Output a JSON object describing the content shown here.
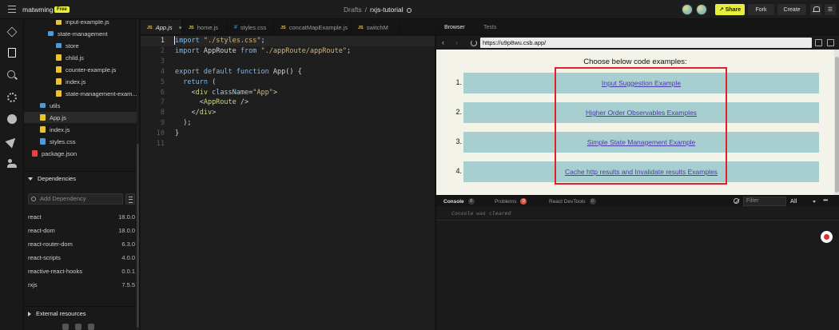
{
  "header": {
    "username": "matwming",
    "plan_badge": "Free",
    "breadcrumb_folder": "Drafts",
    "breadcrumb_separator": "/",
    "project_name": "rxjs-tutorial",
    "share_label": "Share",
    "fork_label": "Fork",
    "create_label": "Create"
  },
  "file_tree": {
    "items": [
      {
        "name": "input-example.js",
        "type": "js",
        "indent": 3
      },
      {
        "name": "state-management",
        "type": "folder",
        "indent": 2
      },
      {
        "name": "store",
        "type": "folder",
        "indent": 3
      },
      {
        "name": "child.js",
        "type": "js",
        "indent": 3
      },
      {
        "name": "counter-example.js",
        "type": "js",
        "indent": 3
      },
      {
        "name": "index.js",
        "type": "js",
        "indent": 3
      },
      {
        "name": "state-management-exam...",
        "type": "js",
        "indent": 3
      },
      {
        "name": "utils",
        "type": "folder",
        "indent": 1
      },
      {
        "name": "App.js",
        "type": "js",
        "indent": 1,
        "active": true
      },
      {
        "name": "index.js",
        "type": "js",
        "indent": 1
      },
      {
        "name": "styles.css",
        "type": "css",
        "indent": 1
      },
      {
        "name": "package.json",
        "type": "json",
        "indent": 0
      }
    ]
  },
  "dependencies": {
    "section_title": "Dependencies",
    "search_placeholder": "Add Dependency",
    "items": [
      {
        "name": "react",
        "version": "18.0.0"
      },
      {
        "name": "react-dom",
        "version": "18.0.0"
      },
      {
        "name": "react-router-dom",
        "version": "6.3.0"
      },
      {
        "name": "react-scripts",
        "version": "4.0.0"
      },
      {
        "name": "reactive-react-hooks",
        "version": "0.0.1"
      },
      {
        "name": "rxjs",
        "version": "7.5.5"
      }
    ]
  },
  "external_resources": {
    "section_title": "External resources"
  },
  "editor": {
    "tabs": [
      {
        "label": "App.js",
        "kind": "js",
        "active": true
      },
      {
        "label": "home.js",
        "kind": "js"
      },
      {
        "label": "styles.css",
        "kind": "css"
      },
      {
        "label": "concatMapExample.js",
        "kind": "js"
      },
      {
        "label": "switchM",
        "kind": "js"
      }
    ],
    "code_lines": [
      {
        "n": "1",
        "current": true,
        "tokens": [
          {
            "t": "import",
            "c": "kw"
          },
          {
            "t": " ",
            "c": "plain"
          },
          {
            "t": "\"./styles.css\"",
            "c": "str"
          },
          {
            "t": ";",
            "c": "plain"
          }
        ]
      },
      {
        "n": "2",
        "tokens": [
          {
            "t": "import",
            "c": "kw"
          },
          {
            "t": " AppRoute ",
            "c": "plain"
          },
          {
            "t": "from",
            "c": "kw"
          },
          {
            "t": " ",
            "c": "plain"
          },
          {
            "t": "\"./appRoute/appRoute\"",
            "c": "str"
          },
          {
            "t": ";",
            "c": "plain"
          }
        ]
      },
      {
        "n": "3",
        "tokens": []
      },
      {
        "n": "4",
        "tokens": [
          {
            "t": "export",
            "c": "kw"
          },
          {
            "t": " ",
            "c": "plain"
          },
          {
            "t": "default",
            "c": "kw"
          },
          {
            "t": " ",
            "c": "plain"
          },
          {
            "t": "function",
            "c": "kw"
          },
          {
            "t": " App() {",
            "c": "plain"
          }
        ]
      },
      {
        "n": "5",
        "tokens": [
          {
            "t": "  ",
            "c": "plain"
          },
          {
            "t": "return",
            "c": "kw"
          },
          {
            "t": " (",
            "c": "plain"
          }
        ]
      },
      {
        "n": "6",
        "tokens": [
          {
            "t": "    <",
            "c": "plain"
          },
          {
            "t": "div",
            "c": "tag"
          },
          {
            "t": " ",
            "c": "plain"
          },
          {
            "t": "className",
            "c": "attr"
          },
          {
            "t": "=",
            "c": "plain"
          },
          {
            "t": "\"App\"",
            "c": "str"
          },
          {
            "t": ">",
            "c": "plain"
          }
        ]
      },
      {
        "n": "7",
        "tokens": [
          {
            "t": "      <",
            "c": "plain"
          },
          {
            "t": "AppRoute",
            "c": "tag"
          },
          {
            "t": " />",
            "c": "plain"
          }
        ]
      },
      {
        "n": "8",
        "tokens": [
          {
            "t": "    </",
            "c": "plain"
          },
          {
            "t": "div",
            "c": "tag"
          },
          {
            "t": ">",
            "c": "plain"
          }
        ]
      },
      {
        "n": "9",
        "tokens": [
          {
            "t": "  );",
            "c": "plain"
          }
        ]
      },
      {
        "n": "10",
        "tokens": [
          {
            "t": "}",
            "c": "plain"
          }
        ]
      },
      {
        "n": "11",
        "tokens": []
      }
    ]
  },
  "browser": {
    "tab_browser": "Browser",
    "tab_tests": "Tests",
    "url": "https://u9p8wu.csb.app/",
    "page_title": "Choose below code examples:",
    "examples": [
      {
        "num": "1.",
        "label": "Input Suggestion Example"
      },
      {
        "num": "2.",
        "label": "Higher Order Observables Examples"
      },
      {
        "num": "3.",
        "label": "Simple State Management Example"
      },
      {
        "num": "4.",
        "label": "Cache http results and Invalidate results Examples"
      }
    ]
  },
  "console": {
    "tab_console": "Console",
    "console_count": "0",
    "tab_problems": "Problems",
    "problems_count": "0",
    "tab_devtools": "React DevTools",
    "devtools_count": "0",
    "filter_placeholder": "Filter",
    "level": "All",
    "message": "Console was cleared"
  },
  "colors": {
    "accent": "#e5ef3c",
    "highlight_box": "#e0202a",
    "example_bg": "#a8cfcf",
    "link": "#4a3aa8"
  }
}
